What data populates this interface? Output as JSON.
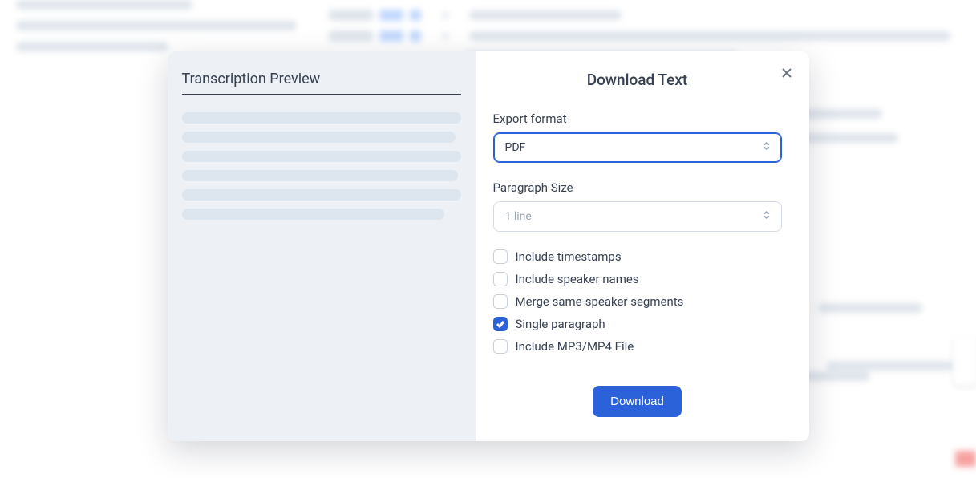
{
  "modal": {
    "preview_title": "Transcription Preview",
    "form_title": "Download Text",
    "export_format_label": "Export format",
    "export_format_value": "PDF",
    "paragraph_size_label": "Paragraph Size",
    "paragraph_size_value": "1 line",
    "options": {
      "include_timestamps": {
        "label": "Include timestamps",
        "checked": false
      },
      "include_speaker_names": {
        "label": "Include speaker names",
        "checked": false
      },
      "merge_same_speaker": {
        "label": "Merge same-speaker segments",
        "checked": false
      },
      "single_paragraph": {
        "label": "Single paragraph",
        "checked": true
      },
      "include_media_file": {
        "label": "Include MP3/MP4 File",
        "checked": false
      }
    },
    "download_button": "Download"
  }
}
